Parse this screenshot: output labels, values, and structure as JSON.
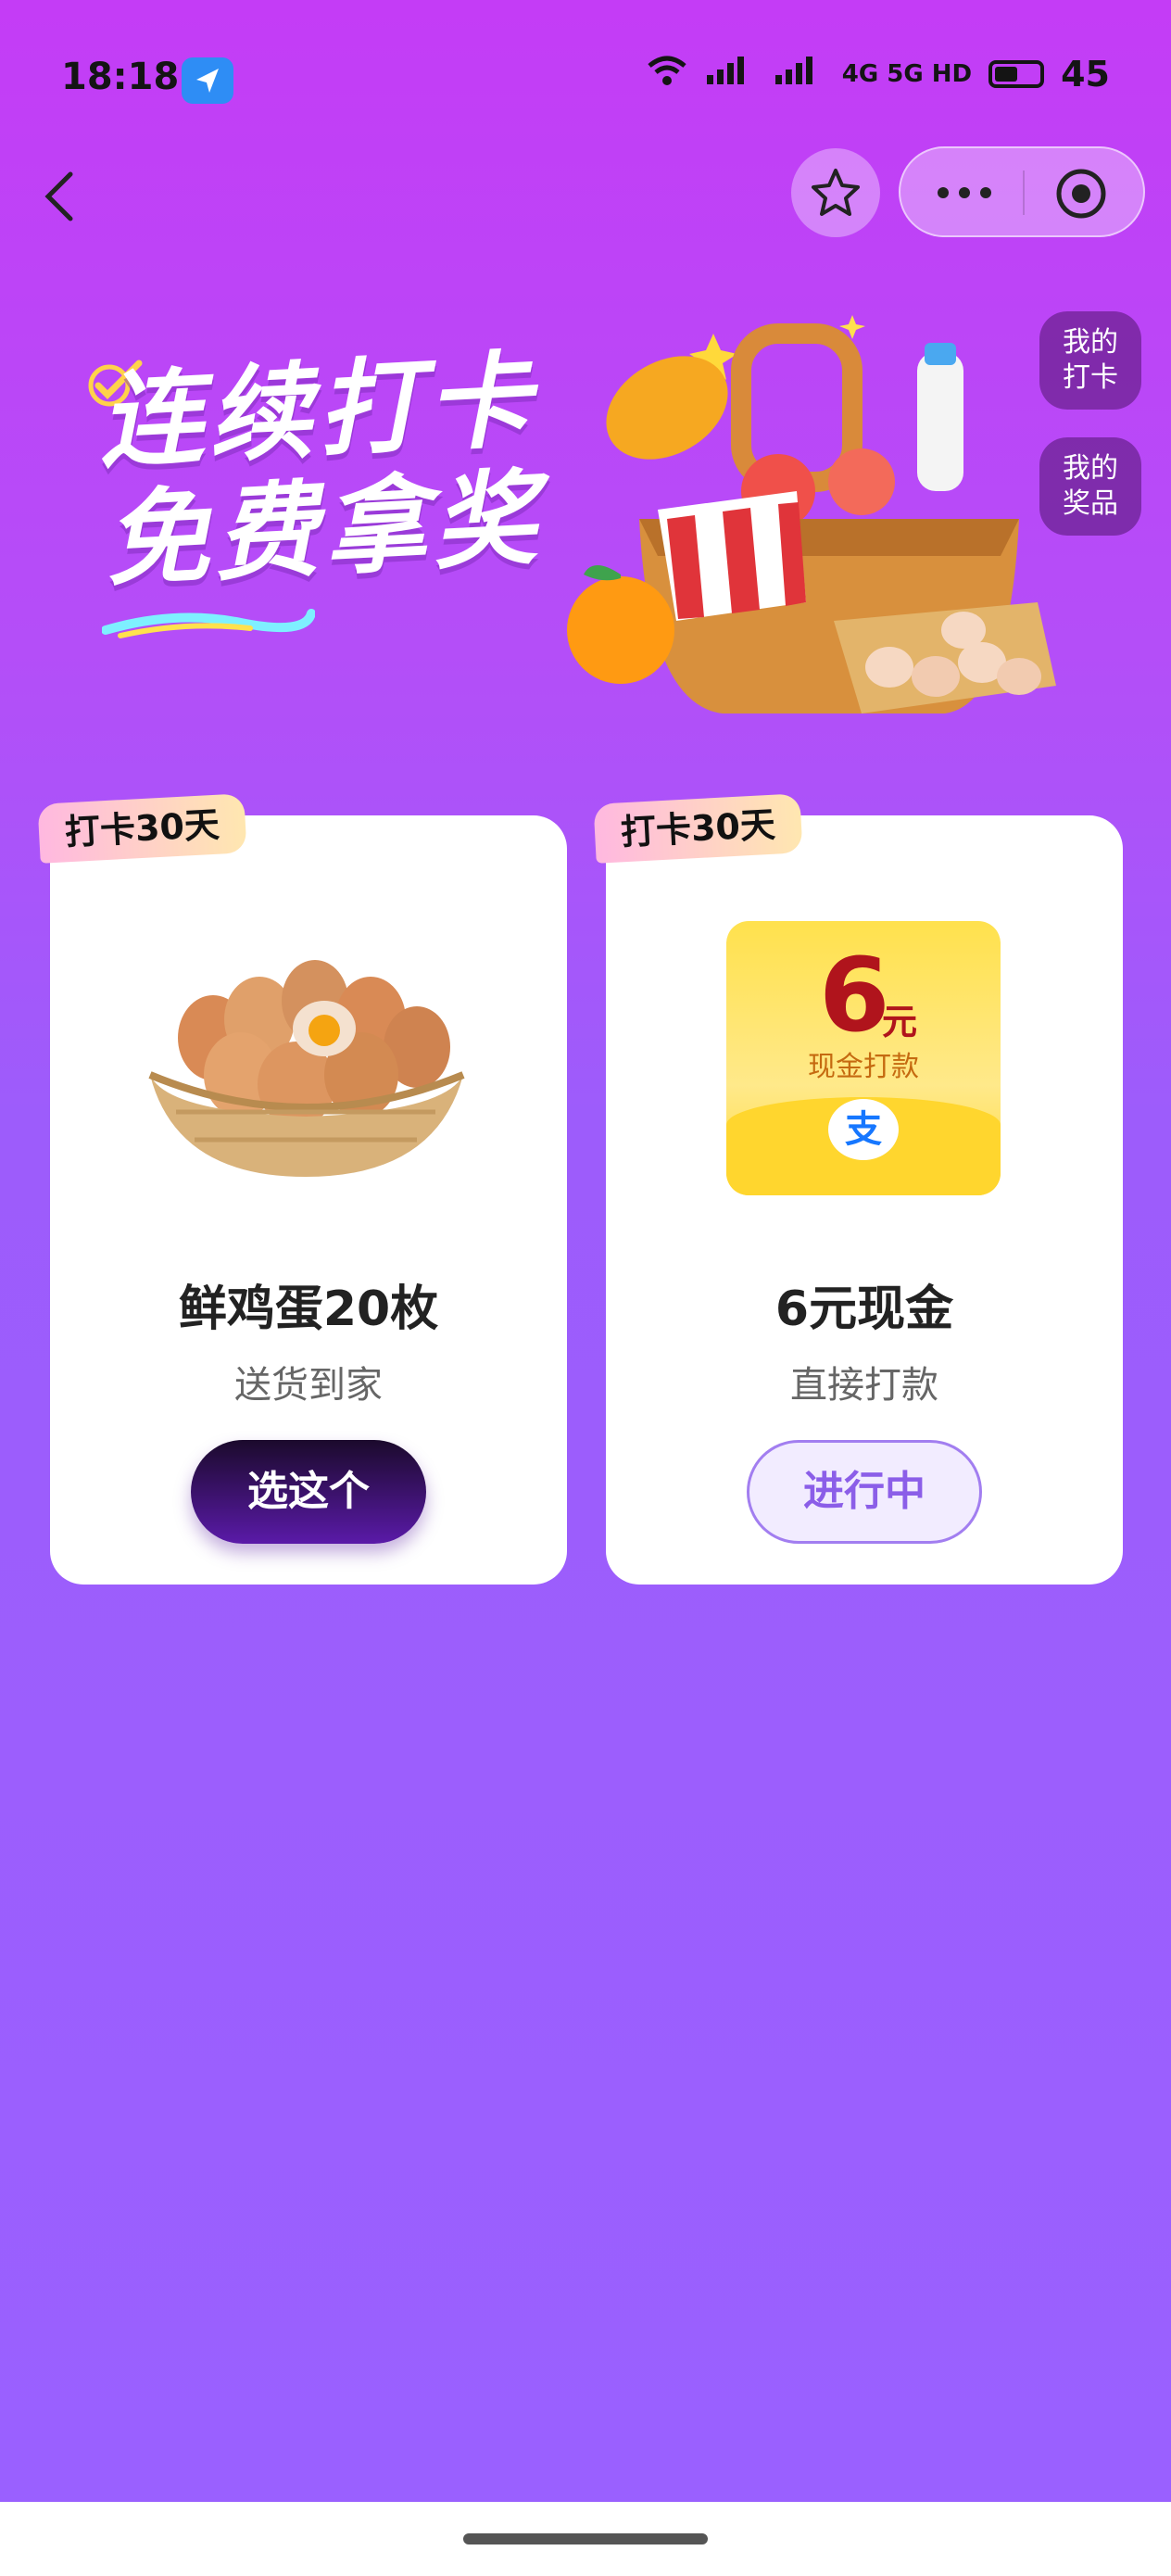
{
  "status_bar": {
    "time": "18:18",
    "network": "4G 5G HD",
    "battery": "45"
  },
  "nav": {
    "back_icon": "chevron-left-icon",
    "favorite_icon": "star-icon",
    "more_icon": "more-dots-icon",
    "target_icon": "record-target-icon"
  },
  "banner": {
    "title_line1": "连续打卡",
    "title_line2": "免费拿奖"
  },
  "side_buttons": [
    {
      "label_line1": "我的",
      "label_line2": "打卡"
    },
    {
      "label_line1": "我的",
      "label_line2": "奖品"
    }
  ],
  "cards": [
    {
      "tag": "打卡30天",
      "title": "鲜鸡蛋20枚",
      "subtitle": "送货到家",
      "button": "选这个"
    },
    {
      "tag": "打卡30天",
      "title": "6元现金",
      "subtitle": "直接打款",
      "button": "进行中",
      "cash_amount": "6",
      "cash_unit": "元",
      "cash_caption": "现金打款",
      "payment_icon_char": "支"
    }
  ],
  "colors": {
    "bg_top": "#c43cf6",
    "bg_bottom": "#9a60ff",
    "primary_button": "#2a0d4a",
    "secondary_button_text": "#8b5ee8"
  }
}
